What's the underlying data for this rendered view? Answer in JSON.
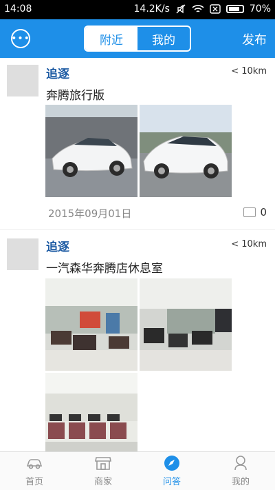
{
  "status_bar": {
    "time": "14:08",
    "network_speed": "14.2K/s",
    "battery": "70%"
  },
  "header": {
    "segments": [
      "附近",
      "我的"
    ],
    "active_segment": 0,
    "publish_label": "发布"
  },
  "posts": [
    {
      "username": "追逐",
      "distance": "< 10km",
      "title": "奔腾旅行版",
      "date": "2015年09月01日",
      "comment_count": "0"
    },
    {
      "username": "追逐",
      "distance": "< 10km",
      "title": "一汽森华奔腾店休息室"
    }
  ],
  "tabbar": {
    "items": [
      {
        "label": "首页",
        "icon": "car-icon"
      },
      {
        "label": "商家",
        "icon": "shop-icon"
      },
      {
        "label": "问答",
        "icon": "compass-icon"
      },
      {
        "label": "我的",
        "icon": "person-icon"
      }
    ],
    "active_index": 2
  },
  "colors": {
    "accent": "#1e8fe8",
    "username": "#1c5aa3"
  }
}
